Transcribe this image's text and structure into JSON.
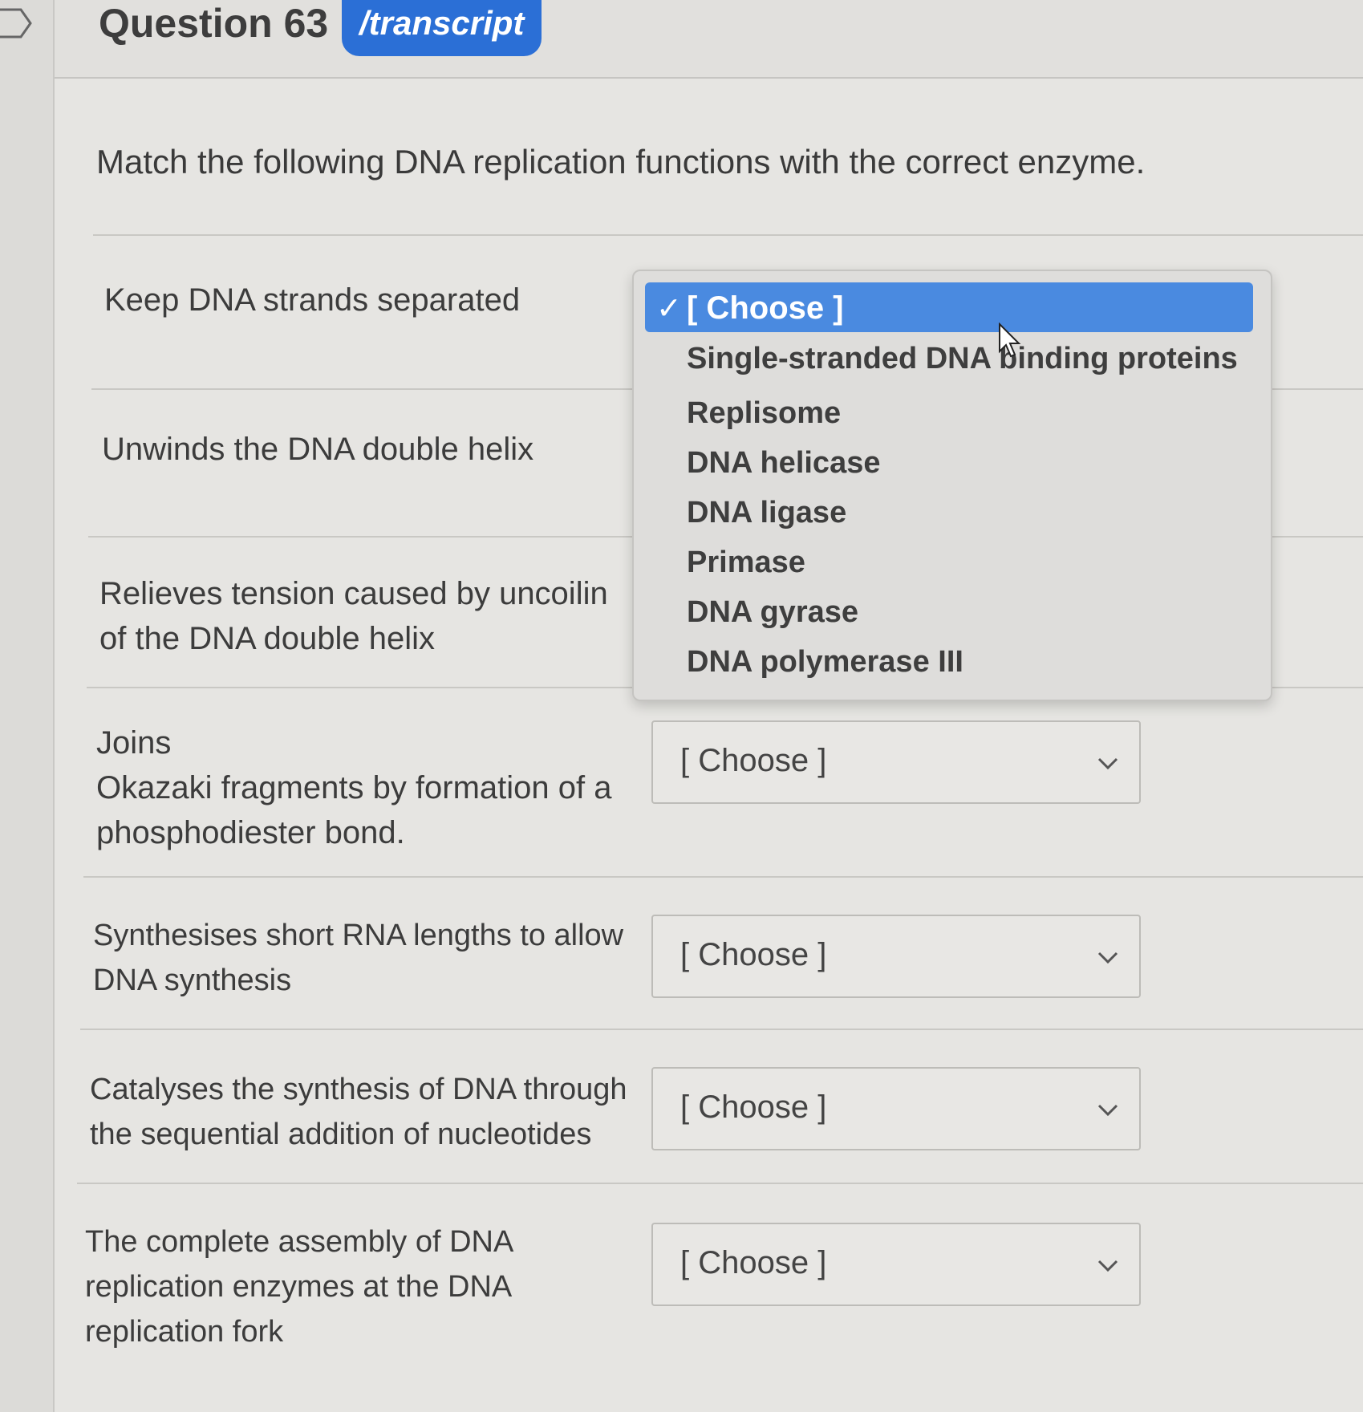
{
  "header": {
    "question_title": "Question 63",
    "transcript_label": "/transcript"
  },
  "prompt": "Match the following DNA replication functions with the correct enzyme.",
  "rows": [
    {
      "label": "Keep DNA strands separated",
      "selected": "[ Choose ]"
    },
    {
      "label": "Unwinds the DNA double helix",
      "selected": "[ Choose ]"
    },
    {
      "label": "Relieves tension caused by uncoilin of the DNA double helix",
      "selected": "[ Choose ]"
    },
    {
      "label_line1": "Joins",
      "label_line2": "Okazaki fragments by formation of a phosphodiester bond.",
      "selected": "[ Choose ]"
    },
    {
      "label": "Synthesises short RNA lengths to allow DNA synthesis",
      "selected": "[ Choose ]"
    },
    {
      "label": "Catalyses the synthesis of DNA through the sequential addition of nucleotides",
      "selected": "[ Choose ]"
    },
    {
      "label": "The complete assembly of DNA replication enzymes at the DNA replication fork",
      "selected": "[ Choose ]"
    }
  ],
  "dropdown": {
    "selected_label": "[ Choose ]",
    "check": "✓",
    "options": [
      "Single-stranded DNA binding proteins",
      "Replisome",
      "DNA helicase",
      "DNA ligase",
      "Primase",
      "DNA gyrase",
      "DNA polymerase III"
    ]
  },
  "colors": {
    "accent": "#2b6fd6",
    "highlight": "#4a8ae0"
  }
}
